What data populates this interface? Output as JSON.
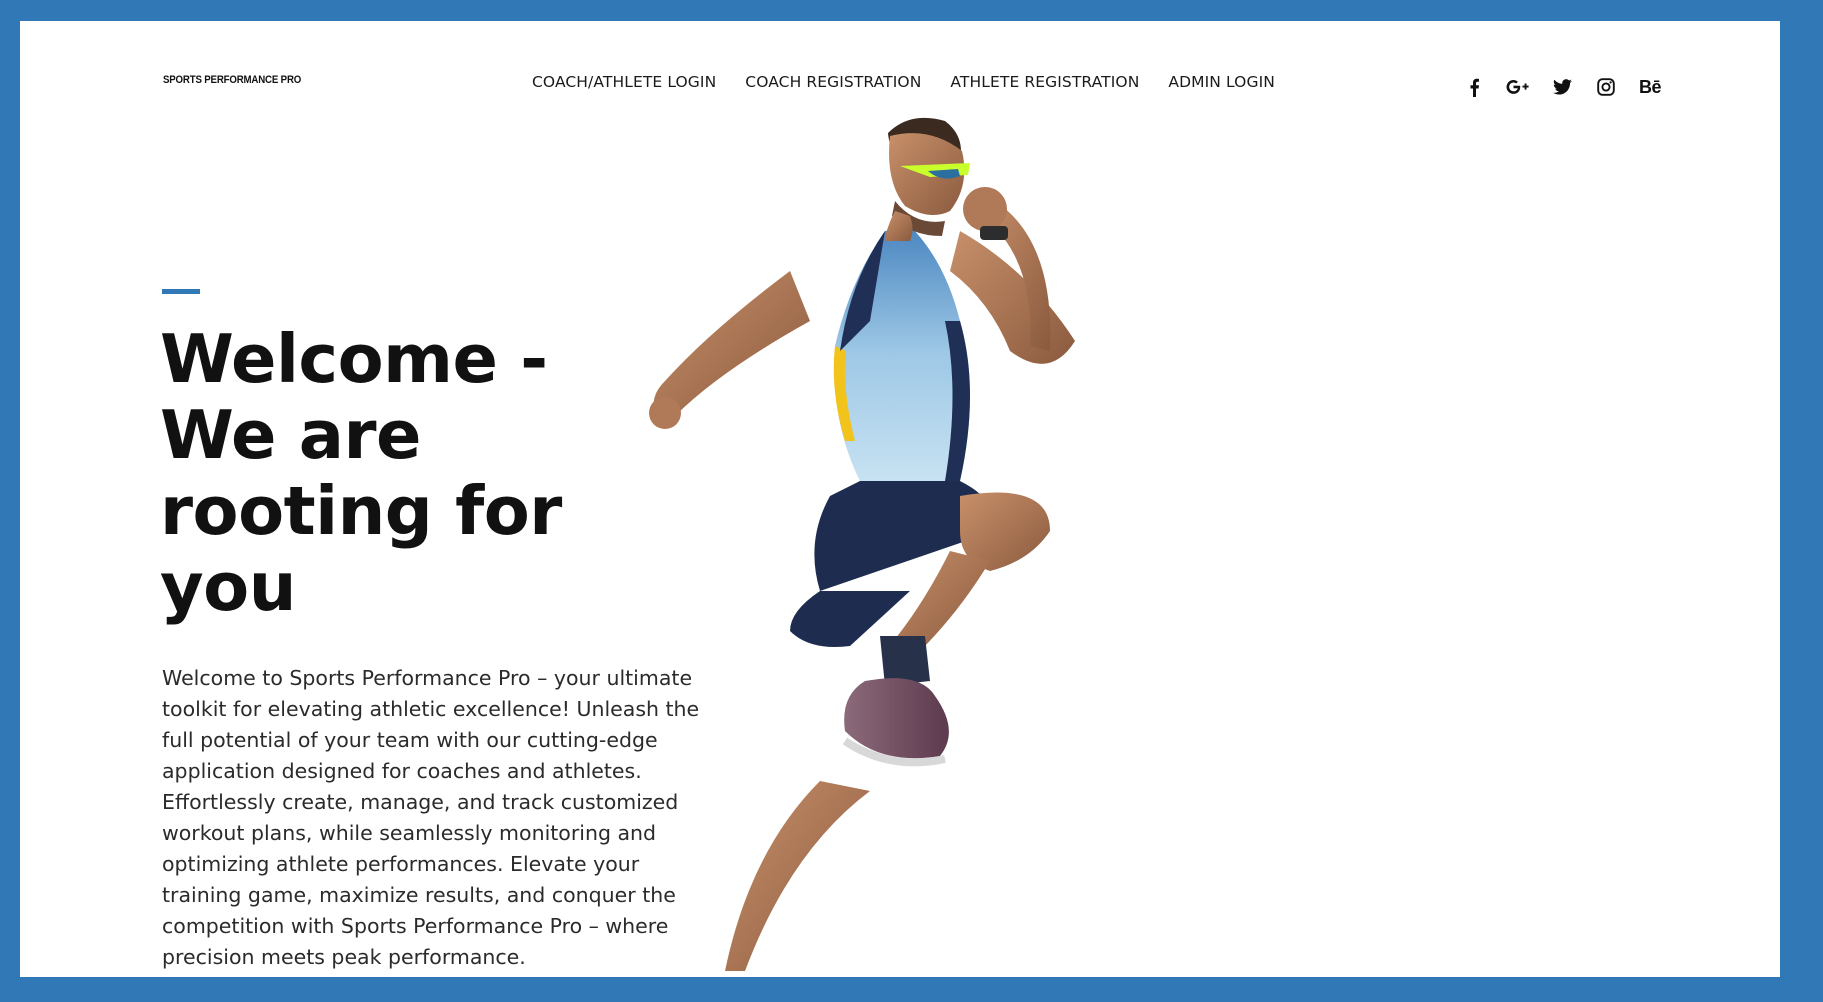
{
  "brand": {
    "name": "SPORTS PERFORMANCE PRO"
  },
  "nav": {
    "items": [
      {
        "label": "COACH/ATHLETE LOGIN"
      },
      {
        "label": "COACH REGISTRATION"
      },
      {
        "label": "ATHLETE REGISTRATION"
      },
      {
        "label": "ADMIN LOGIN"
      }
    ]
  },
  "social": {
    "icons": [
      "facebook-icon",
      "google-plus-icon",
      "twitter-icon",
      "instagram-icon",
      "behance-icon"
    ],
    "behance_label": "Bē"
  },
  "hero": {
    "title_lines": [
      "Welcome -",
      "We are",
      "rooting for",
      "you"
    ],
    "description": "Welcome to Sports Performance Pro – your ultimate toolkit for elevating athletic excellence! Unleash the full potential of your team with our cutting-edge application designed for coaches and athletes. Effortlessly create, manage, and track customized workout plans, while seamlessly monitoring and optimizing athlete performances. Elevate your training game, maximize results, and conquer the competition with Sports Performance Pro – where precision meets peak performance."
  },
  "colors": {
    "accent": "#3178b7",
    "background": "#ffffff",
    "text_dark": "#111111",
    "body_text": "#2b2b2b"
  }
}
